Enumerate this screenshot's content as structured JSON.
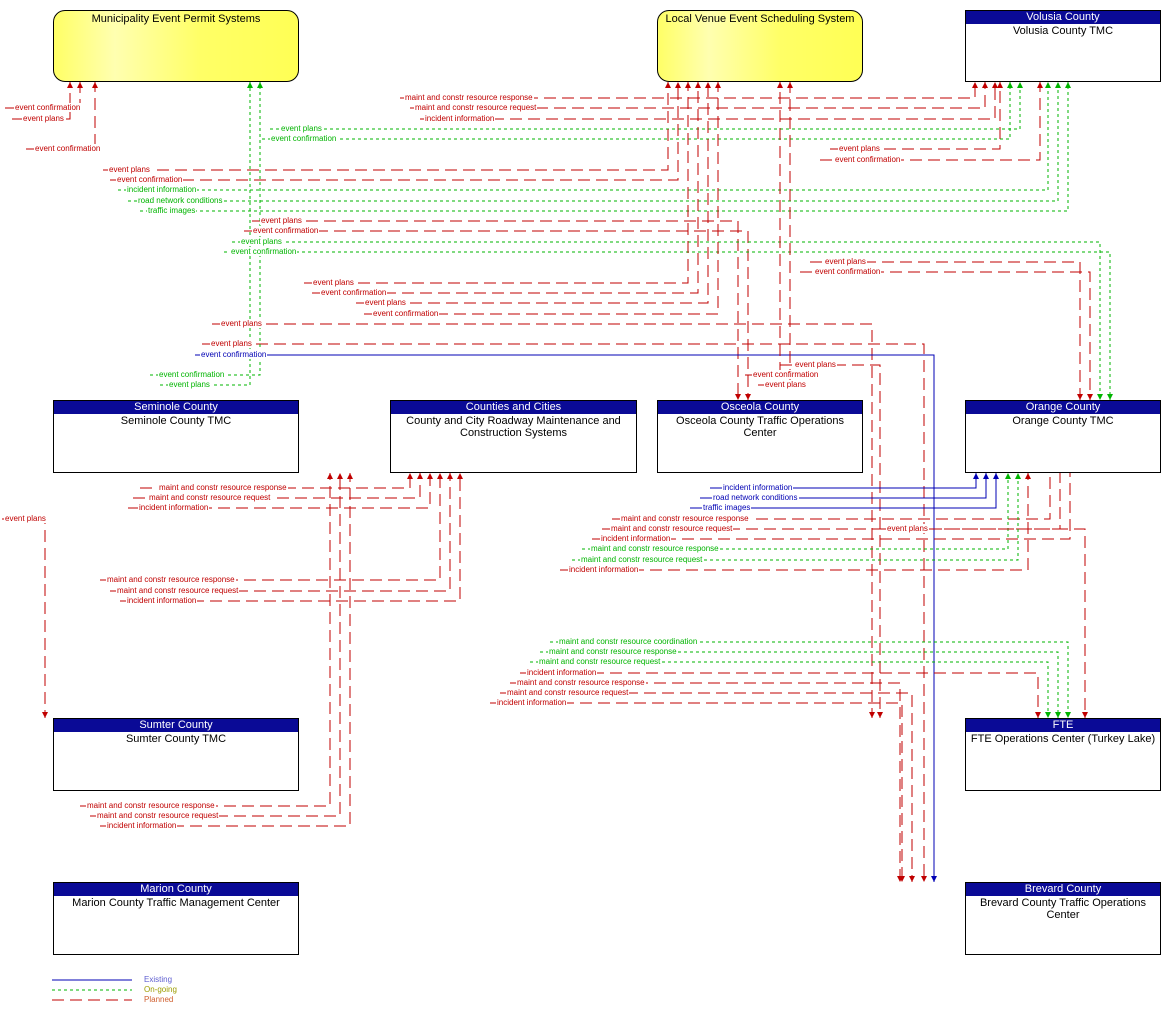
{
  "colors": {
    "existing": "#0000b4",
    "ongoing": "#00b400",
    "planned": "#c00000"
  },
  "boxes": {
    "municipality": {
      "header": "",
      "name": "Municipality Event Permit Systems"
    },
    "venue": {
      "header": "",
      "name": "Local Venue Event Scheduling System"
    },
    "volusia": {
      "header": "Volusia County",
      "name": "Volusia County TMC"
    },
    "seminole": {
      "header": "Seminole County",
      "name": "Seminole County TMC"
    },
    "counties": {
      "header": "Counties and Cities",
      "name": "County and City Roadway Maintenance and Construction Systems"
    },
    "osceola": {
      "header": "Osceola County",
      "name": "Osceola County Traffic Operations Center"
    },
    "orange": {
      "header": "Orange County",
      "name": "Orange County TMC"
    },
    "sumter": {
      "header": "Sumter County",
      "name": "Sumter County TMC"
    },
    "fte": {
      "header": "FTE",
      "name": "FTE Operations Center (Turkey Lake)"
    },
    "marion": {
      "header": "Marion County",
      "name": "Marion County Traffic Management Center"
    },
    "brevard": {
      "header": "Brevard County",
      "name": "Brevard County Traffic Operations Center"
    }
  },
  "flows": [
    {
      "text": "event confirmation",
      "status": "planned"
    },
    {
      "text": "event plans",
      "status": "planned"
    },
    {
      "text": "event confirmation",
      "status": "planned"
    },
    {
      "text": "maint and constr resource response",
      "status": "planned"
    },
    {
      "text": "maint and constr resource request",
      "status": "planned"
    },
    {
      "text": "incident information",
      "status": "planned"
    },
    {
      "text": "event plans",
      "status": "ongoing"
    },
    {
      "text": "event confirmation",
      "status": "ongoing"
    },
    {
      "text": "event plans",
      "status": "planned"
    },
    {
      "text": "event confirmation",
      "status": "planned"
    },
    {
      "text": "event plans",
      "status": "planned"
    },
    {
      "text": "event confirmation",
      "status": "planned"
    },
    {
      "text": "incident information",
      "status": "ongoing"
    },
    {
      "text": "road network conditions",
      "status": "ongoing"
    },
    {
      "text": "traffic images",
      "status": "ongoing"
    },
    {
      "text": "event plans",
      "status": "planned"
    },
    {
      "text": "event confirmation",
      "status": "planned"
    },
    {
      "text": "event plans",
      "status": "ongoing"
    },
    {
      "text": "event confirmation",
      "status": "ongoing"
    },
    {
      "text": "event plans",
      "status": "planned"
    },
    {
      "text": "event confirmation",
      "status": "planned"
    },
    {
      "text": "event plans",
      "status": "planned"
    },
    {
      "text": "event confirmation",
      "status": "planned"
    },
    {
      "text": "event plans",
      "status": "planned"
    },
    {
      "text": "event confirmation",
      "status": "planned"
    },
    {
      "text": "event plans",
      "status": "planned"
    },
    {
      "text": "event plans",
      "status": "planned"
    },
    {
      "text": "event confirmation",
      "status": "existing"
    },
    {
      "text": "event plans",
      "status": "planned"
    },
    {
      "text": "event confirmation",
      "status": "planned"
    },
    {
      "text": "event plans",
      "status": "planned"
    },
    {
      "text": "event confirmation",
      "status": "ongoing"
    },
    {
      "text": "event plans",
      "status": "ongoing"
    },
    {
      "text": "maint and constr resource response",
      "status": "planned"
    },
    {
      "text": "maint and constr resource request",
      "status": "planned"
    },
    {
      "text": "incident information",
      "status": "planned"
    },
    {
      "text": "incident information",
      "status": "existing"
    },
    {
      "text": "road network conditions",
      "status": "existing"
    },
    {
      "text": "traffic images",
      "status": "existing"
    },
    {
      "text": "maint and constr resource response",
      "status": "planned"
    },
    {
      "text": "maint and constr resource request",
      "status": "planned"
    },
    {
      "text": "incident information",
      "status": "planned"
    },
    {
      "text": "maint and constr resource response",
      "status": "ongoing"
    },
    {
      "text": "maint and constr resource request",
      "status": "ongoing"
    },
    {
      "text": "incident information",
      "status": "planned"
    },
    {
      "text": "event plans",
      "status": "planned"
    },
    {
      "text": "event plans",
      "status": "planned"
    },
    {
      "text": "maint and constr resource response",
      "status": "planned"
    },
    {
      "text": "maint and constr resource request",
      "status": "planned"
    },
    {
      "text": "incident information",
      "status": "planned"
    },
    {
      "text": "maint and constr resource coordination",
      "status": "ongoing"
    },
    {
      "text": "maint and constr resource response",
      "status": "ongoing"
    },
    {
      "text": "maint and constr resource request",
      "status": "ongoing"
    },
    {
      "text": "incident information",
      "status": "planned"
    },
    {
      "text": "maint and constr resource response",
      "status": "planned"
    },
    {
      "text": "maint and constr resource request",
      "status": "planned"
    },
    {
      "text": "incident information",
      "status": "planned"
    },
    {
      "text": "maint and constr resource response",
      "status": "planned"
    },
    {
      "text": "maint and constr resource request",
      "status": "planned"
    },
    {
      "text": "incident information",
      "status": "planned"
    }
  ],
  "legend": {
    "existing": "Existing",
    "ongoing": "On-going",
    "planned": "Planned"
  }
}
